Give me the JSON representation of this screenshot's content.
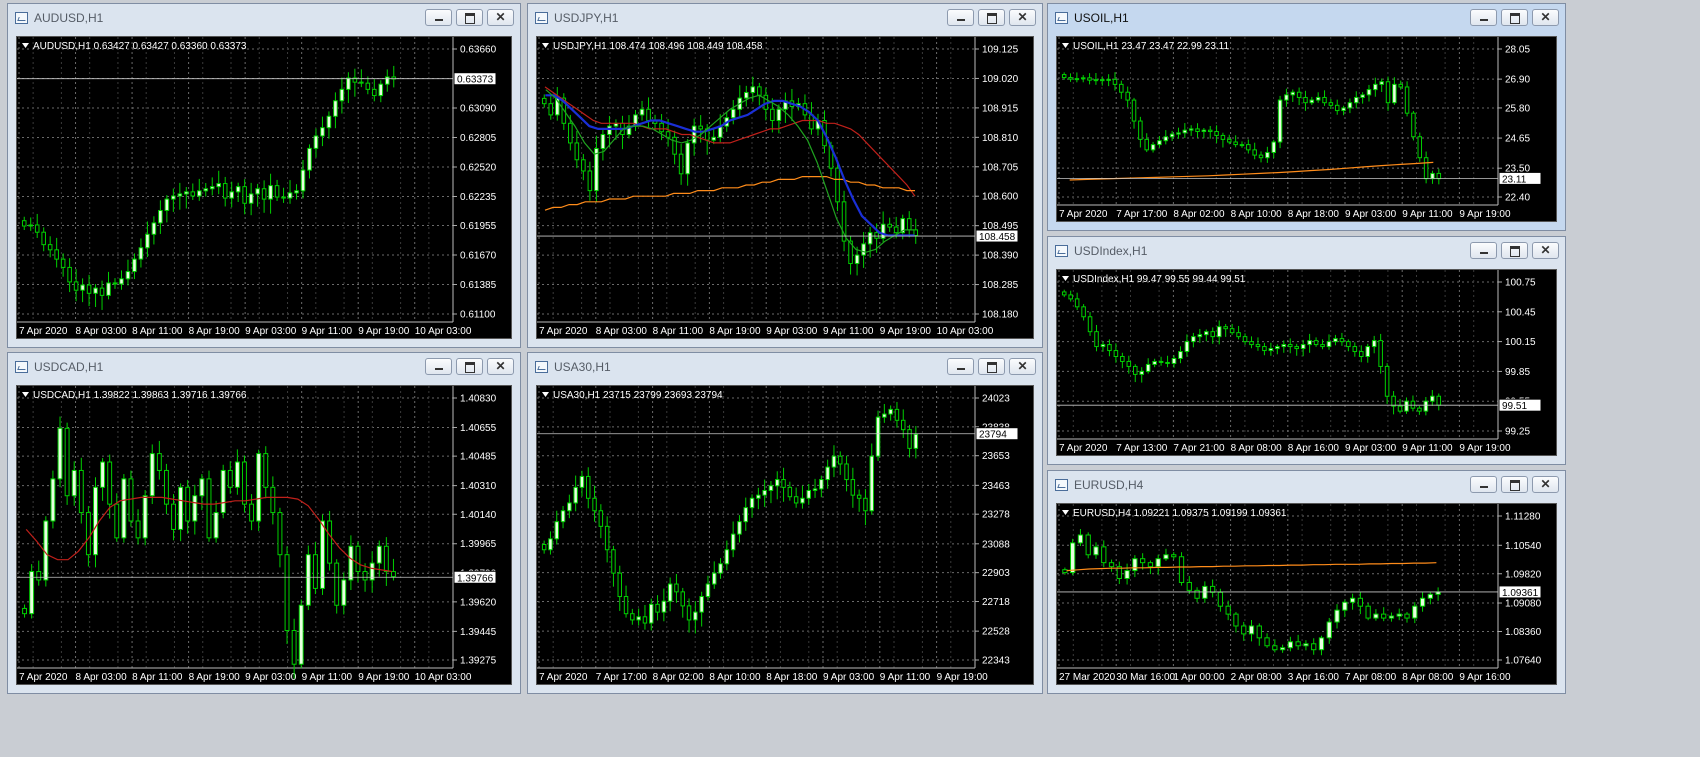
{
  "colors": {
    "background": "#000000",
    "grid": "#6a6a6a",
    "text": "#ffffff",
    "bull_fill": "#e8ffe0",
    "wick": "#00d000",
    "ma_red": "#c0201a",
    "ma_orange": "#ff8c1a",
    "ma_blue": "#1a2fd6",
    "ma_green": "#1fa31f",
    "bid_line": "#c8c8c8"
  },
  "window_buttons": {
    "minimize": "minimize-icon",
    "maximize": "maximize-icon",
    "close": "close-icon",
    "close_glyph": "✕"
  },
  "windows": [
    {
      "id": "audusd",
      "title": "AUDUSD,H1",
      "active": false,
      "info": "AUDUSD,H1  0.63427 0.63427 0.63360 0.63373",
      "price_label": "0.63373",
      "price": 0.63373,
      "y_ticks": [
        "0.63660",
        "0.63375",
        "0.63090",
        "0.62805",
        "0.62520",
        "0.62235",
        "0.61955",
        "0.61670",
        "0.61385",
        "0.61100"
      ],
      "ylim": [
        0.611,
        0.6366
      ],
      "x_ticks": [
        "7 Apr 2020",
        "8 Apr 03:00",
        "8 Apr 11:00",
        "8 Apr 19:00",
        "9 Apr 03:00",
        "9 Apr 11:00",
        "9 Apr 19:00",
        "10 Apr 03:00"
      ],
      "closes": [
        0.6195,
        0.6196,
        0.6189,
        0.6177,
        0.6172,
        0.6163,
        0.6155,
        0.6141,
        0.6133,
        0.6138,
        0.613,
        0.6135,
        0.6128,
        0.614,
        0.6139,
        0.6144,
        0.6151,
        0.6163,
        0.6174,
        0.6187,
        0.6198,
        0.621,
        0.6221,
        0.6224,
        0.6226,
        0.6228,
        0.6224,
        0.6229,
        0.6231,
        0.6233,
        0.6236,
        0.6222,
        0.6228,
        0.6233,
        0.6217,
        0.6226,
        0.6231,
        0.6221,
        0.6234,
        0.6223,
        0.6222,
        0.6227,
        0.6229,
        0.6249,
        0.627,
        0.6282,
        0.629,
        0.6301,
        0.6316,
        0.6327,
        0.6338,
        0.6334,
        0.6333,
        0.6327,
        0.6321,
        0.6332,
        0.6339,
        0.6337
      ],
      "ma": []
    },
    {
      "id": "usdjpy",
      "title": "USDJPY,H1",
      "active": false,
      "info": "USDJPY,H1  108.474 108.496 108.449 108.458",
      "price_label": "108.458",
      "price": 108.458,
      "y_ticks": [
        "109.125",
        "109.020",
        "108.915",
        "108.810",
        "108.705",
        "108.600",
        "108.495",
        "108.390",
        "108.285",
        "108.180"
      ],
      "ylim": [
        108.18,
        109.125
      ],
      "x_ticks": [
        "7 Apr 2020",
        "8 Apr 03:00",
        "8 Apr 11:00",
        "8 Apr 19:00",
        "9 Apr 03:00",
        "9 Apr 11:00",
        "9 Apr 19:00",
        "10 Apr 03:00"
      ],
      "closes": [
        108.93,
        108.89,
        108.95,
        108.86,
        108.79,
        108.73,
        108.69,
        108.62,
        108.77,
        108.82,
        108.85,
        108.86,
        108.82,
        108.85,
        108.89,
        108.91,
        108.87,
        108.86,
        108.83,
        108.81,
        108.75,
        108.68,
        108.79,
        108.85,
        108.84,
        108.8,
        108.81,
        108.85,
        108.88,
        108.91,
        108.95,
        108.97,
        108.99,
        108.96,
        108.91,
        108.87,
        108.91,
        108.94,
        108.92,
        108.93,
        108.89,
        108.84,
        108.87,
        108.78,
        108.7,
        108.58,
        108.44,
        108.36,
        108.39,
        108.43,
        108.47,
        108.45,
        108.5,
        108.49,
        108.47,
        108.52,
        108.48,
        108.46
      ],
      "ma": [
        {
          "name": "ma-red",
          "color": "#c0201a",
          "values": [
            108.99,
            108.97,
            108.95,
            108.93,
            108.91,
            108.89,
            108.87,
            108.86,
            108.86,
            108.86,
            108.86,
            108.86,
            108.85,
            108.84,
            108.84,
            108.84,
            108.83,
            108.82,
            108.82,
            108.81,
            108.8,
            108.79,
            108.79,
            108.79,
            108.8,
            108.81,
            108.82,
            108.83,
            108.84,
            108.84,
            108.85,
            108.86,
            108.87,
            108.87,
            108.87,
            108.86,
            108.86,
            108.85,
            108.84,
            108.82,
            108.79,
            108.76,
            108.73,
            108.7,
            108.67,
            108.64,
            108.6
          ]
        },
        {
          "name": "ma-orange",
          "color": "#ff8c1a",
          "values": [
            108.55,
            108.56,
            108.56,
            108.57,
            108.57,
            108.58,
            108.58,
            108.58,
            108.59,
            108.59,
            108.59,
            108.6,
            108.6,
            108.6,
            108.6,
            108.6,
            108.61,
            108.61,
            108.61,
            108.62,
            108.62,
            108.62,
            108.63,
            108.63,
            108.63,
            108.64,
            108.64,
            108.65,
            108.65,
            108.66,
            108.66,
            108.66,
            108.67,
            108.67,
            108.67,
            108.67,
            108.66,
            108.66,
            108.65,
            108.65,
            108.64,
            108.64,
            108.63,
            108.63,
            108.63,
            108.62,
            108.62
          ]
        },
        {
          "name": "ma-blue",
          "color": "#1a2fd6",
          "values": [
            108.96,
            108.96,
            108.94,
            108.91,
            108.88,
            108.85,
            108.84,
            108.84,
            108.84,
            108.84,
            108.85,
            108.86,
            108.87,
            108.87,
            108.86,
            108.85,
            108.84,
            108.83,
            108.83,
            108.84,
            108.85,
            108.87,
            108.88,
            108.89,
            108.91,
            108.93,
            108.94,
            108.94,
            108.93,
            108.92,
            108.9,
            108.87,
            108.81,
            108.74,
            108.66,
            108.59,
            108.53,
            108.5,
            108.47,
            108.46,
            108.46,
            108.46,
            108.46
          ]
        },
        {
          "name": "ma-green",
          "color": "#1fa31f",
          "values": [
            108.98,
            108.95,
            108.9,
            108.85,
            108.79,
            108.75,
            108.76,
            108.8,
            108.84,
            108.85,
            108.85,
            108.84,
            108.82,
            108.8,
            108.79,
            108.8,
            108.82,
            108.85,
            108.88,
            108.91,
            108.93,
            108.95,
            108.96,
            108.94,
            108.92,
            108.89,
            108.85,
            108.8,
            108.72,
            108.62,
            108.52,
            108.45,
            108.41,
            108.4,
            108.41,
            108.44,
            108.46,
            108.48,
            108.48
          ]
        }
      ]
    },
    {
      "id": "usoil",
      "title": "USOIL,H1",
      "active": true,
      "info": "USOIL,H1  23.47 23.47 22.99 23.11",
      "price_label": "23.11",
      "price": 23.11,
      "y_ticks": [
        "28.05",
        "26.90",
        "25.80",
        "24.65",
        "23.50",
        "22.40"
      ],
      "ylim": [
        22.4,
        28.05
      ],
      "x_ticks": [
        "7 Apr 2020",
        "7 Apr 17:00",
        "8 Apr 02:00",
        "8 Apr 10:00",
        "8 Apr 18:00",
        "9 Apr 03:00",
        "9 Apr 11:00",
        "9 Apr 19:00"
      ],
      "closes": [
        26.96,
        26.9,
        26.92,
        26.95,
        26.86,
        26.88,
        26.85,
        26.89,
        26.7,
        26.4,
        26.1,
        25.3,
        24.6,
        24.2,
        24.4,
        24.55,
        24.7,
        24.8,
        24.85,
        24.95,
        25.0,
        24.9,
        24.95,
        24.9,
        24.75,
        24.6,
        24.5,
        24.4,
        24.4,
        24.2,
        24.0,
        23.9,
        24.1,
        24.5,
        26.1,
        26.3,
        26.4,
        26.2,
        26.0,
        26.1,
        26.2,
        26.0,
        25.9,
        25.7,
        25.8,
        26.0,
        26.2,
        26.3,
        26.5,
        26.7,
        26.8,
        26.0,
        26.7,
        26.6,
        25.6,
        24.7,
        23.9,
        23.1,
        23.3,
        23.1
      ],
      "ma": [
        {
          "name": "ma-orange",
          "color": "#ff8c1a",
          "values": [
            23.05,
            23.07,
            23.09,
            23.11,
            23.13,
            23.15,
            23.17,
            23.19,
            23.21,
            23.24,
            23.27,
            23.3,
            23.33,
            23.37,
            23.41,
            23.45,
            23.5,
            23.55,
            23.6,
            23.64,
            23.68,
            23.72
          ]
        }
      ]
    },
    {
      "id": "usdindex",
      "title": "USDIndex,H1",
      "active": false,
      "info": "USDIndex,H1  99.47 99.55 99.44 99.51",
      "price_label": "99.51",
      "price": 99.51,
      "y_ticks": [
        "100.75",
        "100.45",
        "100.15",
        "99.85",
        "99.55",
        "99.25"
      ],
      "ylim": [
        99.25,
        100.75
      ],
      "x_ticks": [
        "7 Apr 2020",
        "7 Apr 13:00",
        "7 Apr 21:00",
        "8 Apr 08:00",
        "8 Apr 16:00",
        "9 Apr 03:00",
        "9 Apr 11:00",
        "9 Apr 19:00"
      ],
      "closes": [
        100.62,
        100.58,
        100.5,
        100.4,
        100.25,
        100.1,
        100.12,
        100.06,
        100.0,
        99.95,
        99.9,
        99.82,
        99.85,
        99.92,
        99.95,
        99.94,
        99.93,
        99.98,
        100.05,
        100.15,
        100.2,
        100.22,
        100.25,
        100.2,
        100.3,
        100.28,
        100.24,
        100.2,
        100.15,
        100.12,
        100.1,
        100.06,
        100.08,
        100.1,
        100.12,
        100.1,
        100.08,
        100.12,
        100.16,
        100.12,
        100.1,
        100.15,
        100.18,
        100.15,
        100.1,
        100.05,
        100.0,
        100.1,
        100.16,
        99.9,
        99.6,
        99.5,
        99.45,
        99.55,
        99.48,
        99.45,
        99.55,
        99.6,
        99.51
      ],
      "ma": []
    },
    {
      "id": "usdcad",
      "title": "USDCAD,H1",
      "active": false,
      "info": "USDCAD,H1  1.39822 1.39863 1.39716 1.39766",
      "price_label": "1.39766",
      "price": 1.39766,
      "y_ticks": [
        "1.40830",
        "1.40655",
        "1.40485",
        "1.40310",
        "1.40140",
        "1.39965",
        "1.39790",
        "1.39620",
        "1.39445",
        "1.39275"
      ],
      "ylim": [
        1.39275,
        1.4083
      ],
      "x_ticks": [
        "7 Apr 2020",
        "8 Apr 03:00",
        "8 Apr 11:00",
        "8 Apr 19:00",
        "9 Apr 03:00",
        "9 Apr 11:00",
        "9 Apr 19:00",
        "10 Apr 03:00"
      ],
      "closes": [
        1.3955,
        1.398,
        1.3975,
        1.401,
        1.4035,
        1.4065,
        1.4025,
        1.404,
        1.4015,
        1.399,
        1.403,
        1.4045,
        1.402,
        1.4,
        1.4035,
        1.401,
        1.4,
        1.4025,
        1.405,
        1.404,
        1.402,
        1.4005,
        1.403,
        1.401,
        1.4025,
        1.4035,
        1.4,
        1.4015,
        1.404,
        1.403,
        1.4045,
        1.402,
        1.401,
        1.405,
        1.403,
        1.4015,
        1.399,
        1.3945,
        1.3925,
        1.396,
        1.399,
        1.397,
        1.401,
        1.3985,
        1.396,
        1.3975,
        1.3995,
        1.398,
        1.3975,
        1.3985,
        1.3995,
        1.398,
        1.3977
      ],
      "ma": [
        {
          "name": "ma-red",
          "color": "#c0201a",
          "values": [
            1.4005,
            1.3998,
            1.399,
            1.3987,
            1.3987,
            1.3992,
            1.4,
            1.401,
            1.4018,
            1.4022,
            1.4023,
            1.4024,
            1.4024,
            1.4024,
            1.4023,
            1.4022,
            1.4021,
            1.402,
            1.402,
            1.4021,
            1.4022,
            1.4022,
            1.4023,
            1.4024,
            1.4024,
            1.4024,
            1.4023,
            1.4019,
            1.4011,
            1.4002,
            1.3994,
            1.3988,
            1.3984,
            1.3982,
            1.3981,
            1.398
          ]
        }
      ]
    },
    {
      "id": "usa30",
      "title": "USA30,H1",
      "active": false,
      "info": "USA30,H1  23715 23799 23693 23794",
      "price_label": "23794",
      "price": 23794,
      "y_ticks": [
        "24023",
        "23838",
        "23653",
        "23463",
        "23278",
        "23088",
        "22903",
        "22718",
        "22528",
        "22343"
      ],
      "ylim": [
        22343,
        24023
      ],
      "x_ticks": [
        "7 Apr 2020",
        "7 Apr 17:00",
        "8 Apr 02:00",
        "8 Apr 10:00",
        "8 Apr 18:00",
        "9 Apr 03:00",
        "9 Apr 11:00",
        "9 Apr 19:00"
      ],
      "closes": [
        23050,
        23120,
        23230,
        23300,
        23350,
        23450,
        23520,
        23380,
        23300,
        23200,
        23050,
        22900,
        22750,
        22640,
        22600,
        22620,
        22580,
        22700,
        22650,
        22720,
        22830,
        22780,
        22690,
        22600,
        22650,
        22750,
        22830,
        22900,
        22960,
        23050,
        23150,
        23230,
        23320,
        23380,
        23400,
        23430,
        23460,
        23500,
        23450,
        23390,
        23350,
        23380,
        23430,
        23440,
        23500,
        23580,
        23650,
        23600,
        23500,
        23400,
        23380,
        23300,
        23650,
        23900,
        23920,
        23950,
        23880,
        23820,
        23700,
        23790
      ],
      "ma": []
    },
    {
      "id": "eurusd",
      "title": "EURUSD,H4",
      "active": false,
      "info": "EURUSD,H4  1.09221 1.09375 1.09199 1.09361",
      "price_label": "1.09361",
      "price": 1.09361,
      "y_ticks": [
        "1.11280",
        "1.10540",
        "1.09820",
        "1.09080",
        "1.08360",
        "1.07640"
      ],
      "ylim": [
        1.0764,
        1.1128
      ],
      "x_ticks": [
        "27 Mar 2020",
        "30 Mar 16:00",
        "1 Apr 00:00",
        "2 Apr 08:00",
        "3 Apr 16:00",
        "7 Apr 08:00",
        "8 Apr 08:00",
        "9 Apr 16:00"
      ],
      "closes": [
        1.0985,
        1.106,
        1.108,
        1.103,
        1.105,
        1.101,
        1.1,
        1.097,
        1.099,
        1.102,
        1.101,
        1.1,
        1.102,
        1.103,
        1.1025,
        1.096,
        1.094,
        1.092,
        1.095,
        1.0935,
        1.09,
        1.088,
        1.085,
        1.083,
        1.085,
        1.082,
        1.08,
        1.079,
        1.0795,
        1.081,
        1.08,
        1.0805,
        1.079,
        1.082,
        1.086,
        1.089,
        1.091,
        1.092,
        1.09,
        1.087,
        1.088,
        1.087,
        1.0875,
        1.088,
        1.087,
        1.09,
        1.092,
        1.093,
        1.0936
      ],
      "ma": [
        {
          "name": "ma-orange",
          "color": "#ff8c1a",
          "values": [
            1.099,
            1.0992,
            1.0994,
            1.0995,
            1.0996,
            1.0996,
            1.0997,
            1.0997,
            1.0998,
            1.0998,
            1.0999,
            1.0999,
            1.1,
            1.1,
            1.1001,
            1.1001,
            1.1002,
            1.1002,
            1.1003,
            1.1003,
            1.1004,
            1.1004,
            1.1005,
            1.1005,
            1.1006,
            1.1006,
            1.1006,
            1.1007,
            1.1007,
            1.1008,
            1.1008,
            1.1009,
            1.1009,
            1.101
          ]
        }
      ]
    }
  ]
}
